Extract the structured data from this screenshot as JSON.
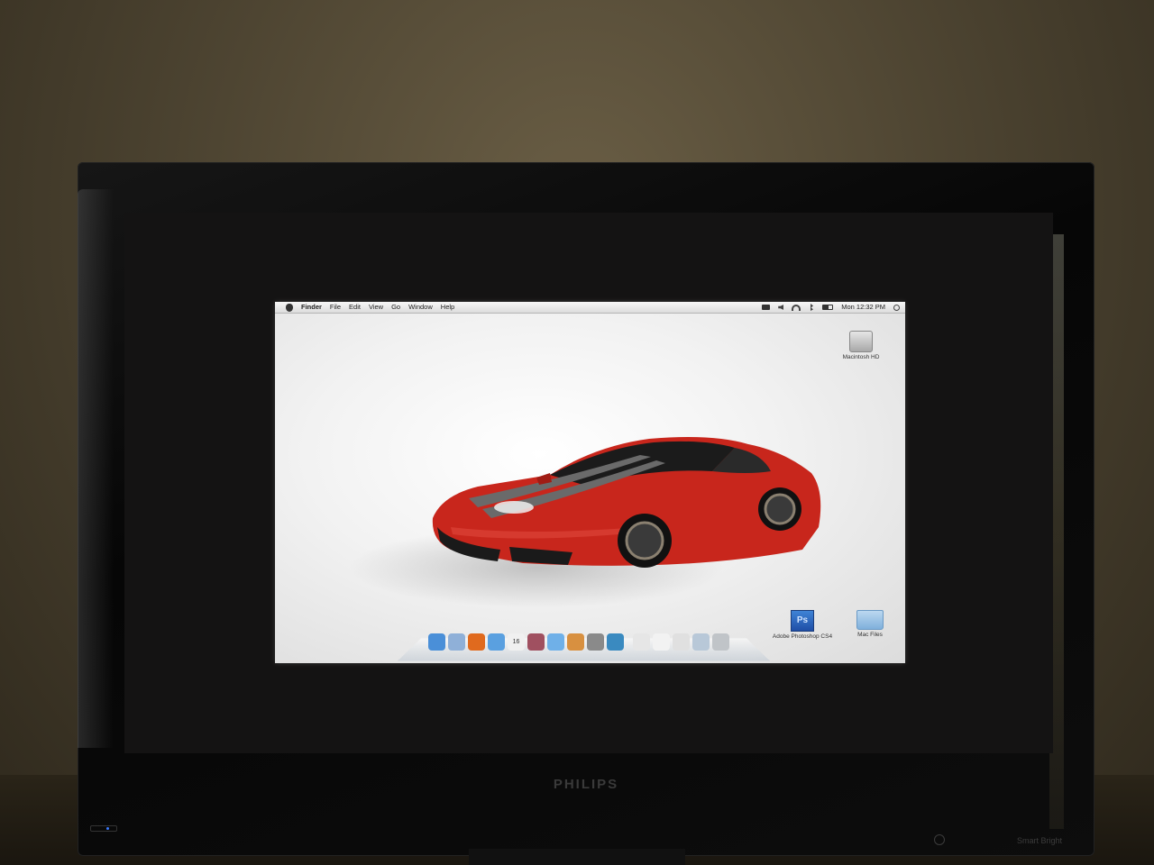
{
  "menubar": {
    "app_name": "Finder",
    "menus": [
      "File",
      "Edit",
      "View",
      "Go",
      "Window",
      "Help"
    ],
    "clock": "Mon 12:32 PM"
  },
  "desktop": {
    "icons": [
      {
        "label": "Macintosh HD",
        "icon": "hard-drive-icon"
      },
      {
        "label": "Adobe Photoshop CS4",
        "icon": "photoshop-icon",
        "glyph": "Ps"
      },
      {
        "label": "Mac Files",
        "icon": "folder-icon"
      }
    ]
  },
  "dock": {
    "items": [
      {
        "name": "finder",
        "color": "#4a8fd8"
      },
      {
        "name": "mail",
        "color": "#8fb0d8"
      },
      {
        "name": "firefox",
        "color": "#e06a1e"
      },
      {
        "name": "safari",
        "color": "#5aa0e0"
      },
      {
        "name": "ical",
        "color": "#f0f0f0",
        "text": "16"
      },
      {
        "name": "preview",
        "color": "#a05060"
      },
      {
        "name": "itunes",
        "color": "#6fb0e8"
      },
      {
        "name": "iphoto",
        "color": "#d89040"
      },
      {
        "name": "system-preferences",
        "color": "#8a8a8a"
      },
      {
        "name": "time-machine",
        "color": "#3a8ac0"
      },
      {
        "name": "separator"
      },
      {
        "name": "document-1",
        "color": "#e6e6e6"
      },
      {
        "name": "document-2",
        "color": "#f2f2f2"
      },
      {
        "name": "document-3",
        "color": "#e0e0e0"
      },
      {
        "name": "downloads",
        "color": "#b8c8d8"
      },
      {
        "name": "trash",
        "color": "#c0c4c8"
      }
    ]
  },
  "monitor": {
    "brand": "PHILIPS",
    "model_text": "Smart Bright"
  },
  "colors": {
    "car_red": "#c8261c",
    "car_stripe": "#6a6a6a"
  }
}
